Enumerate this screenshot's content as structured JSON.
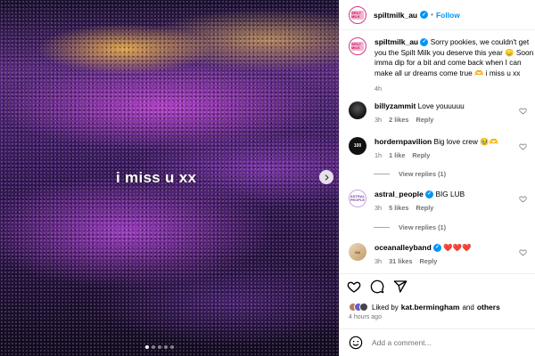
{
  "post": {
    "media_caption": "i miss u xx",
    "carousel_dots": 5,
    "carousel_active": 0
  },
  "header": {
    "username": "spiltmilk_au",
    "separator": "•",
    "follow_label": "Follow",
    "avatar_text": "SPILT MILK"
  },
  "caption": {
    "username": "spiltmilk_au",
    "text": "Sorry pookies, we couldn't get you the Spilt Milk you deserve this year 😞 Soon imma dip for a bit and come back when I can make all ur dreams come true 🫶 i miss u xx",
    "time": "4h"
  },
  "comments": [
    {
      "username": "billyzammit",
      "text": "Love youuuuu",
      "time": "3h",
      "likes": "2 likes",
      "reply": "Reply"
    },
    {
      "username": "hordernpavilion",
      "text": "Big love crew 🥹🫶",
      "time": "1h",
      "likes": "1 like",
      "reply": "Reply",
      "view_replies": "View replies (1)",
      "avatar_text": "100"
    },
    {
      "username": "astral_people",
      "text": "BIG LUB",
      "time": "3h",
      "likes": "5 likes",
      "reply": "Reply",
      "view_replies": "View replies (1)",
      "avatar_text": "ASTRAL PEOPLE"
    },
    {
      "username": "oceanalleyband",
      "text": "❤️❤️❤️",
      "time": "3h",
      "likes": "31 likes",
      "reply": "Reply",
      "avatar_text": "OA"
    }
  ],
  "likes": {
    "liked_by": "Liked by",
    "user": "kat.bermingham",
    "and": "and",
    "others": "others"
  },
  "posted_time": "4 hours ago",
  "comment_box": {
    "placeholder": "Add a comment..."
  },
  "icons": [
    "heart-icon",
    "comment-icon",
    "share-icon",
    "emoji-icon",
    "chevron-right-icon",
    "verified-icon"
  ],
  "colors": {
    "link_blue": "#0095f6",
    "muted_text": "#737373",
    "heart_red": "#ed4956"
  }
}
